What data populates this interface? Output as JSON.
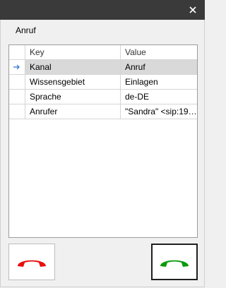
{
  "dialog": {
    "label": "Anruf"
  },
  "icons": {
    "close": "close-icon",
    "row_indicator": "arrow-right-icon",
    "hangup": "phone-hangup-icon",
    "answer": "phone-answer-icon"
  },
  "colors": {
    "titlebar": "#3a3a3a",
    "hangup": "#e80f0f",
    "answer": "#0a9a0a",
    "selected_row": "#d9d9d9",
    "indicator": "#2a6fcf"
  },
  "grid": {
    "columns": [
      "Key",
      "Value"
    ],
    "rows": [
      {
        "key": "Kanal",
        "value": "Anruf"
      },
      {
        "key": "Wissensgebiet",
        "value": "Einlagen"
      },
      {
        "key": "Sprache",
        "value": "de-DE"
      },
      {
        "key": "Anrufer",
        "value": "\"Sandra\" <sip:19@S..."
      }
    ]
  }
}
